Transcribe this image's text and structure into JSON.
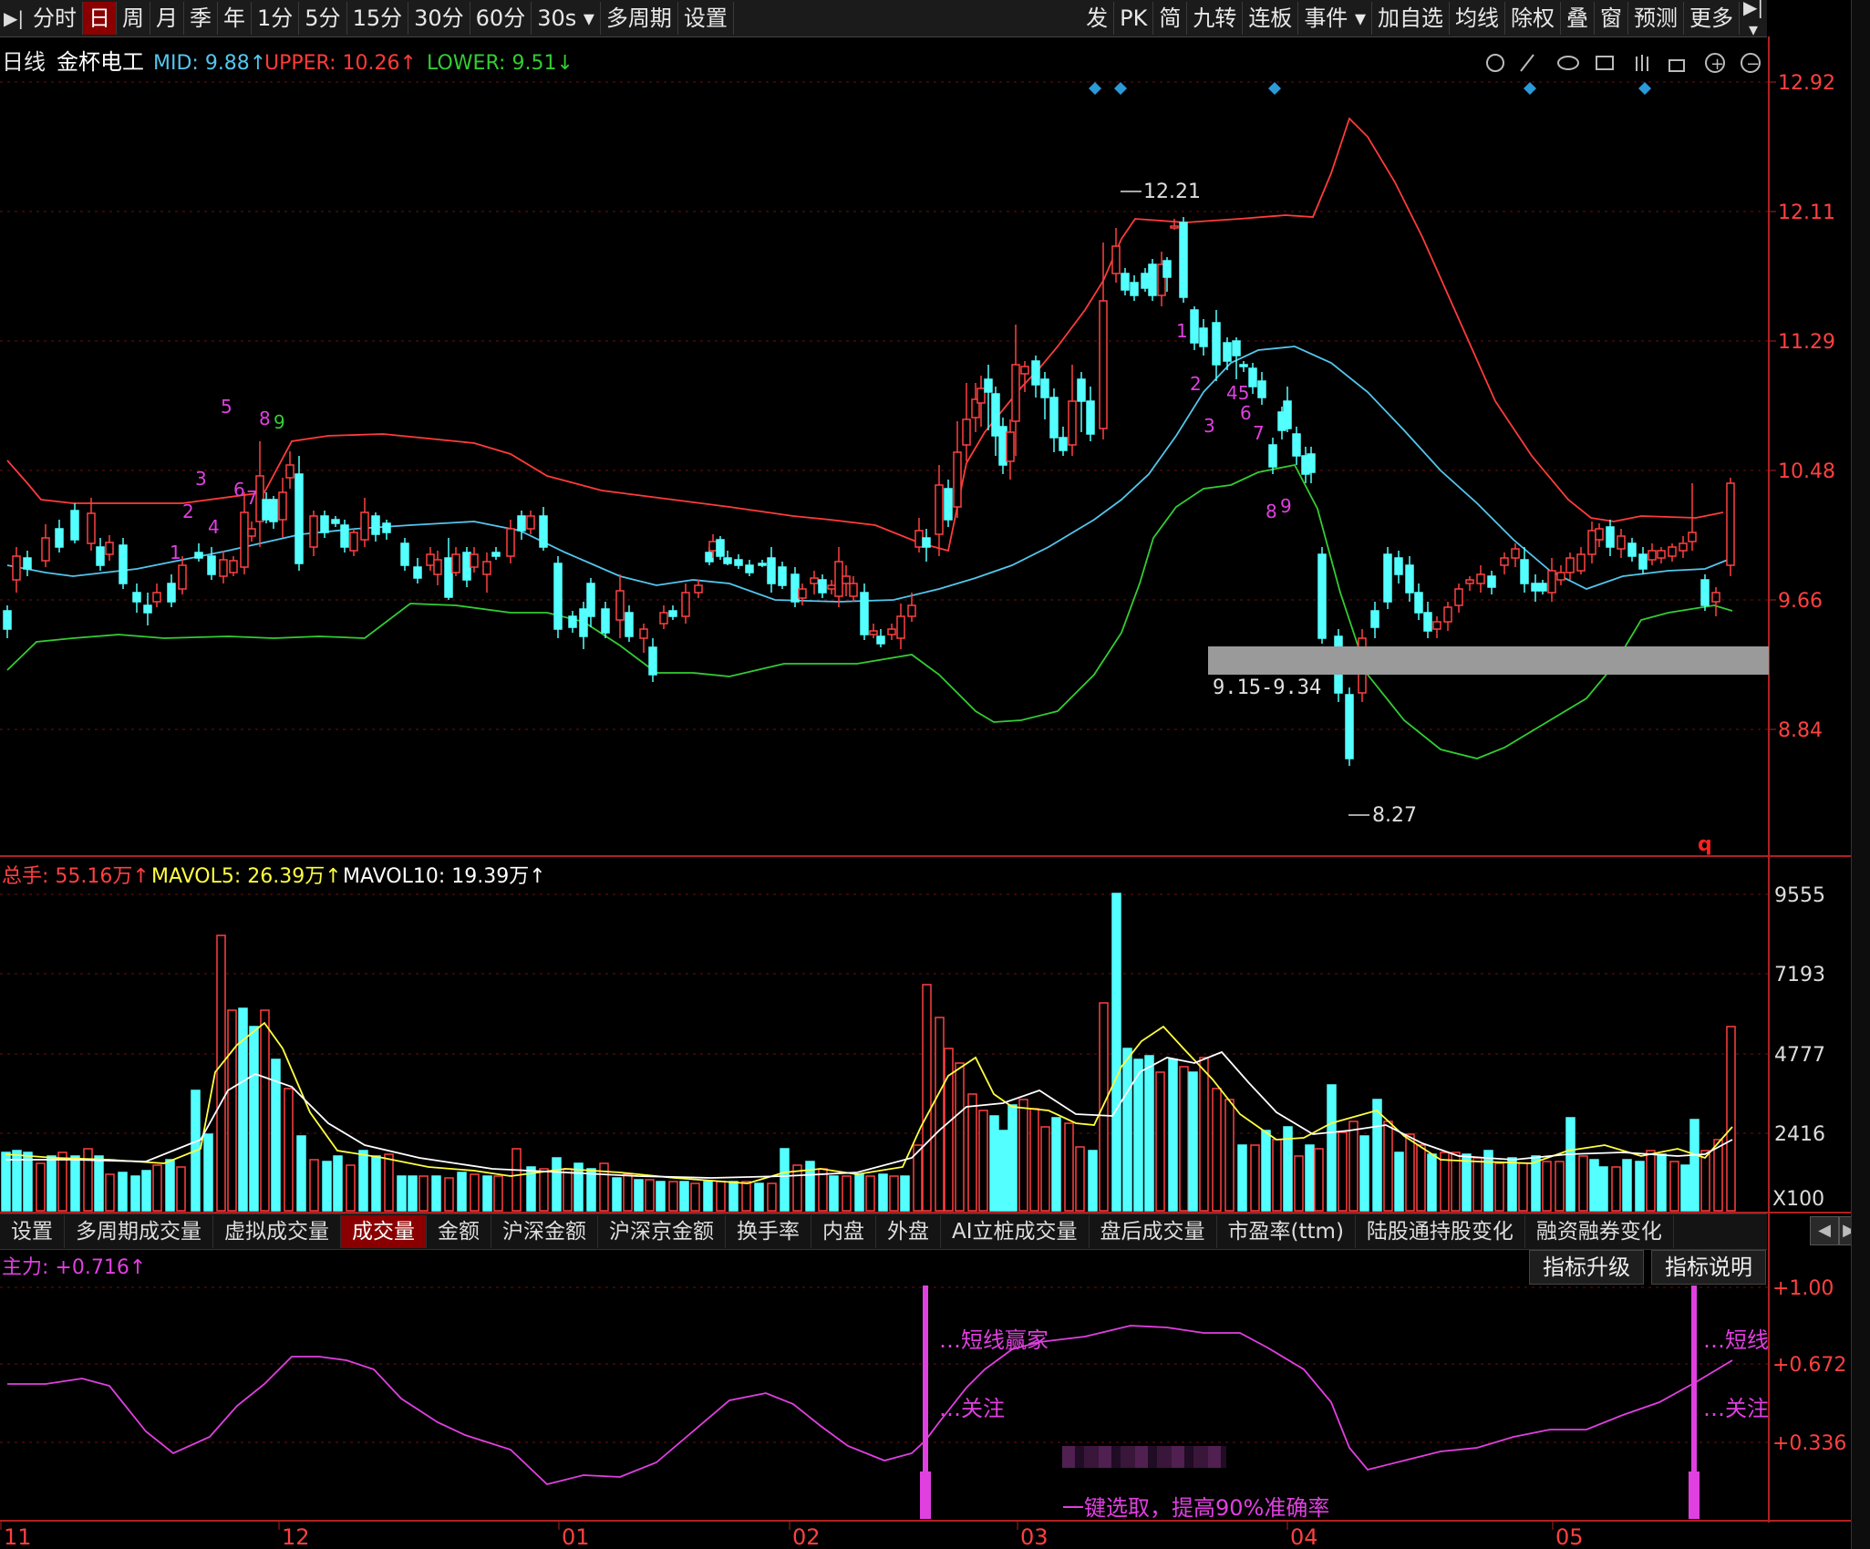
{
  "toolbar": {
    "left": [
      "分时",
      "日",
      "周",
      "月",
      "季",
      "年",
      "1分",
      "5分",
      "15分",
      "30分",
      "60分",
      "30s",
      "多周期",
      "设置"
    ],
    "active": "日",
    "right": [
      "发",
      "PK",
      "简",
      "九转",
      "连板",
      "事件",
      "加自选",
      "均线",
      "除权",
      "叠",
      "窗",
      "预测",
      "更多"
    ]
  },
  "main": {
    "period_label": "日线",
    "stock_name": "金杯电工",
    "mid": "MID: 9.88↑",
    "upper": "UPPER: 10.26↑",
    "lower": "LOWER: 9.51↓",
    "price_ticks": [
      "12.92",
      "12.11",
      "11.29",
      "10.48",
      "9.66",
      "8.84"
    ],
    "high_label": "12.21",
    "low_label": "8.27",
    "zone_label": "9.15-9.34",
    "q_marker": "q",
    "td_labels": [
      "1",
      "2",
      "3",
      "4",
      "5",
      "6",
      "7",
      "8",
      "9",
      "1",
      "2",
      "3",
      "45",
      "6",
      "7",
      "8",
      "9"
    ],
    "colors": {
      "up": "#ff4040",
      "down": "#54ffff",
      "mid": "#53c6ee",
      "upper": "#ff3b3b",
      "lower": "#33cc33",
      "mavol5": "#ffff40",
      "mavol10": "#ffffff",
      "main_force": "#e040e0",
      "zone": "#9a9a9a"
    }
  },
  "volume": {
    "total": "总手: 55.16万↑",
    "mavol5": "MAVOL5: 26.39万↑",
    "mavol10": "MAVOL10: 19.39万↑",
    "ticks": [
      "9555",
      "7193",
      "4777",
      "2416"
    ],
    "unit": "X100"
  },
  "bottom_tabs": [
    "设置",
    "多周期成交量",
    "虚拟成交量",
    "成交量",
    "金额",
    "沪深金额",
    "沪深京金额",
    "换手率",
    "内盘",
    "外盘",
    "AI立桩成交量",
    "盘后成交量",
    "市盈率(ttm)",
    "陆股通持股变化",
    "融资融券变化"
  ],
  "bottom_active": "成交量",
  "indicator": {
    "label": "主力: +0.716↑",
    "upgrade_button": "指标升级",
    "explain_button": "指标说明",
    "ticks": [
      "+1.00",
      "+0.672",
      "+0.336"
    ],
    "signal1": "短线赢家",
    "signal2": "关注",
    "signal1_cut": "短线",
    "signal2_cut": "关注",
    "promo": "一键选取，提高90%准确率"
  },
  "date_axis": [
    "11",
    "12",
    "01",
    "02",
    "03",
    "04",
    "05"
  ]
}
